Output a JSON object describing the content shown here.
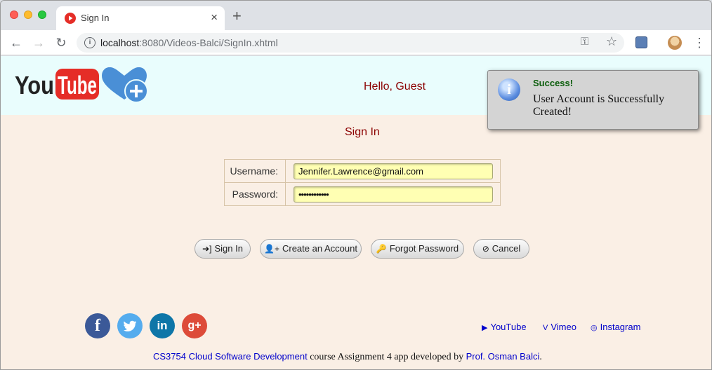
{
  "browser": {
    "tab_title": "Sign In",
    "new_tab": "+",
    "tab_close": "×",
    "url_host": "localhost",
    "url_rest": ":8080/Videos-Balci/SignIn.xhtml"
  },
  "header": {
    "logo_text": "YouTube",
    "greeting": "Hello, Guest"
  },
  "growl": {
    "title": "Success!",
    "message": "User Account is Successfully Created!"
  },
  "main": {
    "title": "Sign In",
    "username_label": "Username:",
    "username_value": "Jennifer.Lawrence@gmail.com",
    "password_label": "Password:",
    "password_value": "••••••••••••"
  },
  "buttons": {
    "sign_in": "Sign In",
    "create_account": "Create an Account",
    "forgot_password": "Forgot Password",
    "cancel": "Cancel"
  },
  "footer": {
    "social": [
      "f",
      "🐦",
      "in",
      "g+"
    ],
    "links": {
      "youtube": "YouTube",
      "vimeo": "Vimeo",
      "instagram": "Instagram"
    },
    "credits": {
      "course_link": "CS3754 Cloud Software Development",
      "middle": " course Assignment 4 app developed by ",
      "author_link": "Prof. Osman Balci",
      "end": "."
    }
  },
  "colors": {
    "header_bg": "#e9fdfd",
    "page_bg": "#faefe5",
    "title_red": "#8b0000",
    "link_blue": "#0000cc",
    "input_bg": "#ffffb3"
  }
}
